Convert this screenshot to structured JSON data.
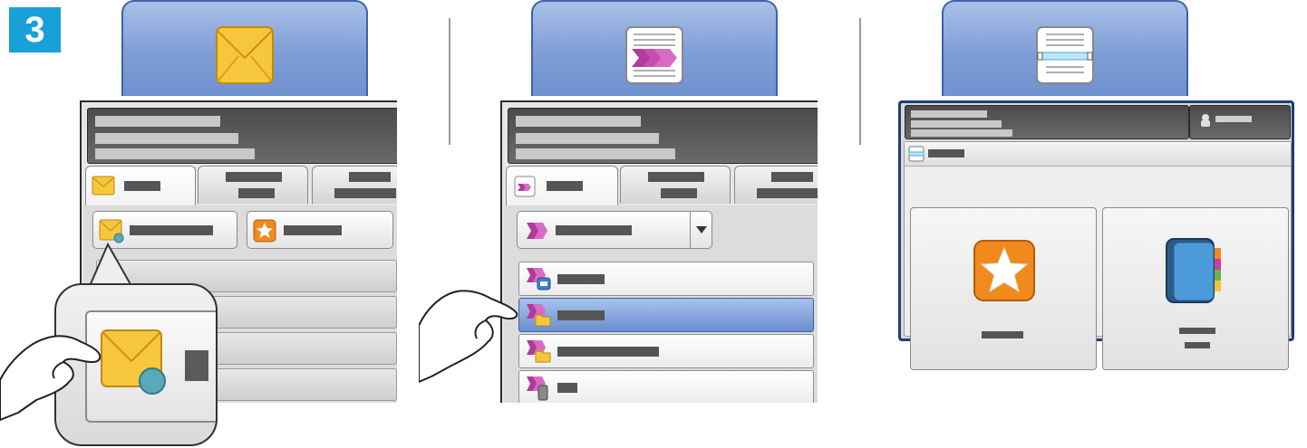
{
  "step": {
    "number": "3"
  },
  "panels": [
    {
      "app": "email",
      "icon": "envelope-icon"
    },
    {
      "app": "workflow-scanning",
      "icon": "workflow-scan-icon"
    },
    {
      "app": "scan-to",
      "icon": "scanner-icon"
    }
  ],
  "colors": {
    "step_badge": "#1aa0d8",
    "app_tab": "#7f9ed6",
    "selected_row": "#6a8fcf",
    "header_bar": "#555555",
    "screen_border": "#1f3f6f"
  }
}
